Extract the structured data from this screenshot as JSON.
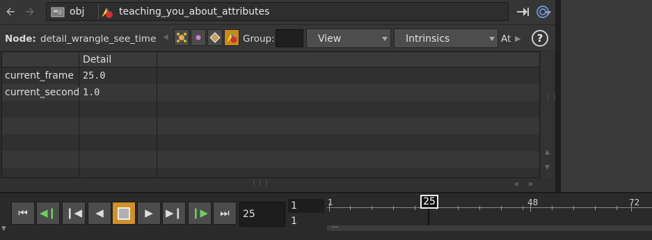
{
  "path": {
    "back_icon": "back-arrow-icon",
    "forward_icon": "forward-arrow-icon",
    "context": "obj",
    "asset": "teaching_you_about_attributes"
  },
  "toolbar": {
    "node_label": "Node:",
    "node_name": "detail_wrangle_see_time",
    "group_label": "Group:",
    "group_value": "",
    "view_label": "View",
    "intrinsics_label": "Intrinsics",
    "at_label": "At",
    "help_label": "?"
  },
  "sheet": {
    "column_header": "Detail",
    "rows": [
      {
        "name": "current_frame",
        "value": "25.0"
      },
      {
        "name": "current_second",
        "value": "1.0"
      }
    ]
  },
  "playbar": {
    "current_frame": "25",
    "range_start": "1",
    "range_end": "1",
    "timeline_labels": [
      "1",
      "48",
      "72"
    ],
    "cursor_frame": "25"
  },
  "colors": {
    "accent_orange": "#d0902a",
    "background": "#2b2b2b"
  }
}
